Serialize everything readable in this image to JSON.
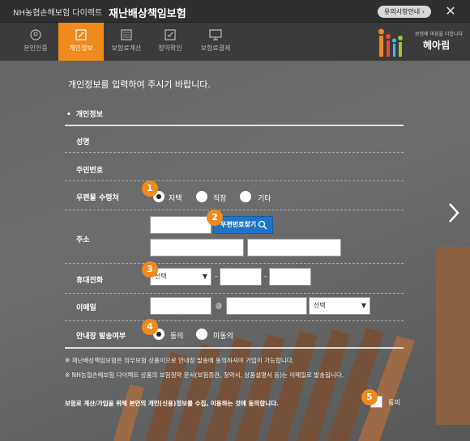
{
  "titlebar": {
    "brand": "NH농협손해보험 다이렉트",
    "product": "재난배상책임보험",
    "notice": "유의사항안내 ›",
    "close": "✕"
  },
  "tabs": [
    {
      "label": "본인인증",
      "icon": "person-icon"
    },
    {
      "label": "개인정보",
      "icon": "edit-icon"
    },
    {
      "label": "보험료계산",
      "icon": "calculator-icon"
    },
    {
      "label": "청약확인",
      "icon": "checkbox-icon"
    },
    {
      "label": "보험료결제",
      "icon": "monitor-icon"
    }
  ],
  "logo": {
    "tagline": "보험에 마음을 더합니다",
    "name": "헤아림"
  },
  "form": {
    "intro": "개인정보를 입력하여 주시기 바랍니다.",
    "section_title": "개인정보",
    "name_label": "성명",
    "rrn_label": "주민번호",
    "mail_label": "우편물 수령처",
    "mail_options": [
      "자택",
      "직장",
      "기타"
    ],
    "address_label": "주소",
    "zip_button": "우편번호찾기",
    "phone_label": "휴대전화",
    "phone_select": "선택",
    "phone_sep": "-",
    "email_label": "이메일",
    "email_at": "@",
    "email_select": "선택",
    "notice_label": "안내장 발송여부",
    "notice_options": [
      "동의",
      "미동의"
    ],
    "note1": "※ 재난배상책임보험은 의무보험 상품이므로 안내장 발송에 동의하셔야 가입이 가능합니다.",
    "note2": "※ NH농협손해보험 다이렉트 상품의 보험청약 문서(보험증권, 청약서, 상품설명서 등)는 이메일로 발송됩니다.",
    "consent": "보험료 계산/가입을 위해 본인의 개인(신용)정보를 수집, 이용하는 것에 동의합니다.",
    "consent_check": "동의"
  },
  "badges": [
    "1",
    "2",
    "3",
    "4",
    "5"
  ],
  "colors": {
    "accent": "#f08a1c",
    "button_blue": "#1e74c7"
  }
}
